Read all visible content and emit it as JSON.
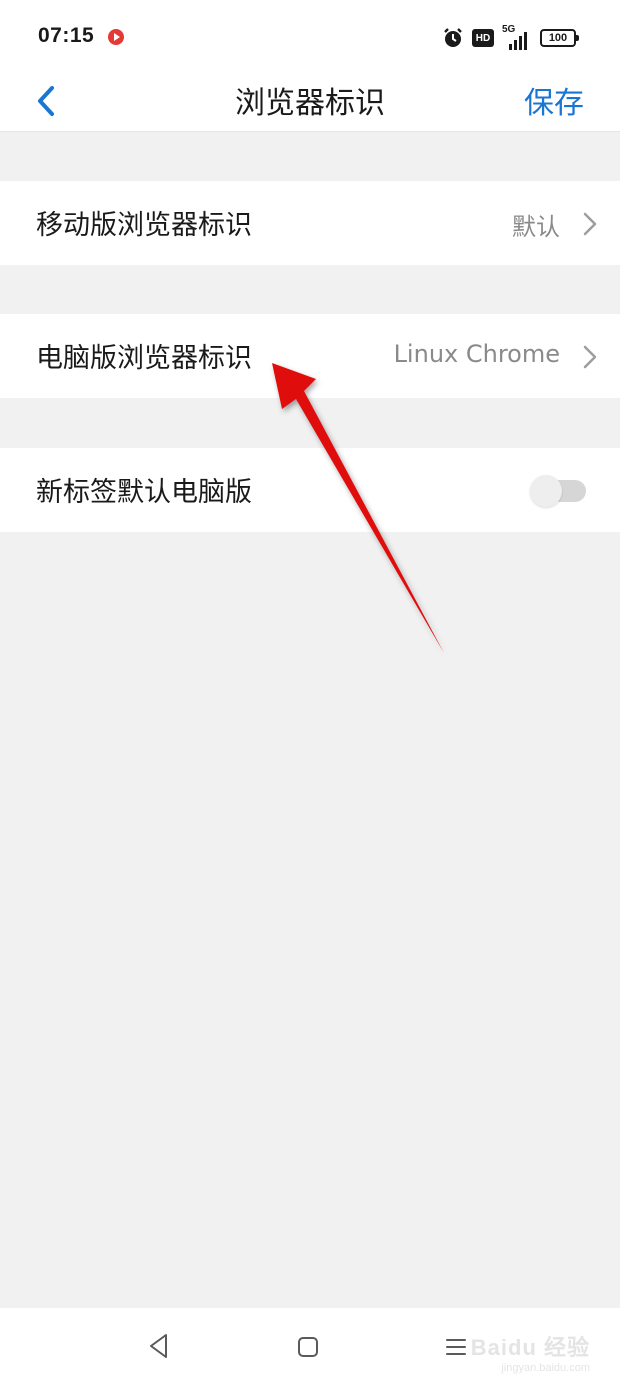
{
  "status_bar": {
    "time": "07:15",
    "hd_label": "HD",
    "network_type": "5G",
    "battery": "100"
  },
  "header": {
    "title": "浏览器标识",
    "save_label": "保存"
  },
  "items": [
    {
      "label": "移动版浏览器标识",
      "value": "默认"
    },
    {
      "label": "电脑版浏览器标识",
      "value": "Linux Chrome"
    },
    {
      "label": "新标签默认电脑版",
      "toggle_on": false
    }
  ],
  "colors": {
    "accent": "#1976d2",
    "annotation_arrow": "#e01010",
    "background": "#f1f1f1"
  },
  "watermark": {
    "brand": "Baidu 经验",
    "sub": "jingyan.baidu.com"
  }
}
